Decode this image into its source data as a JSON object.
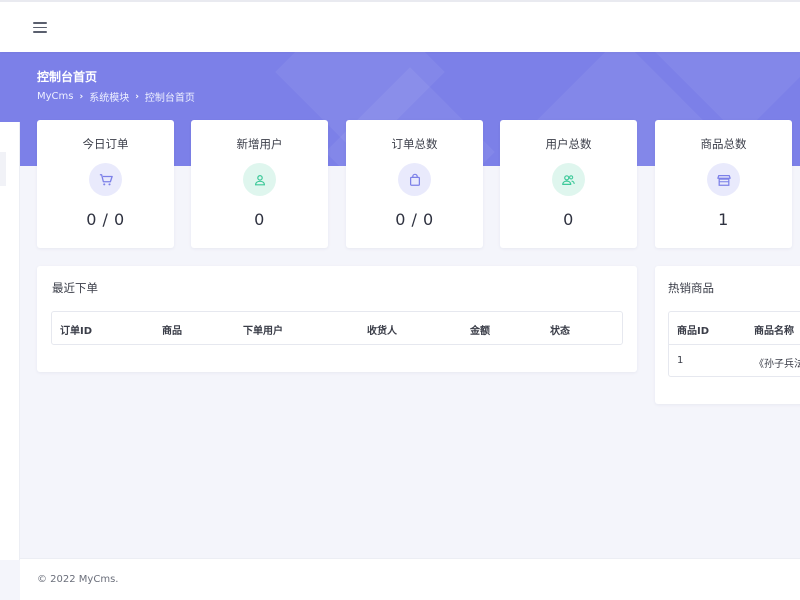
{
  "header": {
    "menu_icon": "hamburger-menu-icon"
  },
  "hero": {
    "title": "控制台首页",
    "breadcrumb": [
      "MyCms",
      "系统模块",
      "控制台首页"
    ]
  },
  "stats": [
    {
      "title": "今日订单",
      "value": "0 / 0",
      "icon": "cart-icon",
      "color": "#7c80e8",
      "bg": "#e9eafc"
    },
    {
      "title": "新增用户",
      "value": "0",
      "icon": "user-icon",
      "color": "#3ec99a",
      "bg": "#dff6ee"
    },
    {
      "title": "订单总数",
      "value": "0 / 0",
      "icon": "bag-icon",
      "color": "#7c80e8",
      "bg": "#e9eafc"
    },
    {
      "title": "用户总数",
      "value": "0",
      "icon": "users-icon",
      "color": "#3ec99a",
      "bg": "#dff6ee"
    },
    {
      "title": "商品总数",
      "value": "1",
      "icon": "store-icon",
      "color": "#7c80e8",
      "bg": "#e9eafc"
    }
  ],
  "recent_orders": {
    "title": "最近下单",
    "columns": [
      "订单ID",
      "商品",
      "下单用户",
      "收货人",
      "金额",
      "状态"
    ]
  },
  "hot_products": {
    "title": "热销商品",
    "columns": [
      "商品ID",
      "商品名称"
    ],
    "rows": [
      [
        "1",
        "《孙子兵法"
      ]
    ]
  },
  "footer": {
    "copyright": "© 2022 MyCms."
  }
}
